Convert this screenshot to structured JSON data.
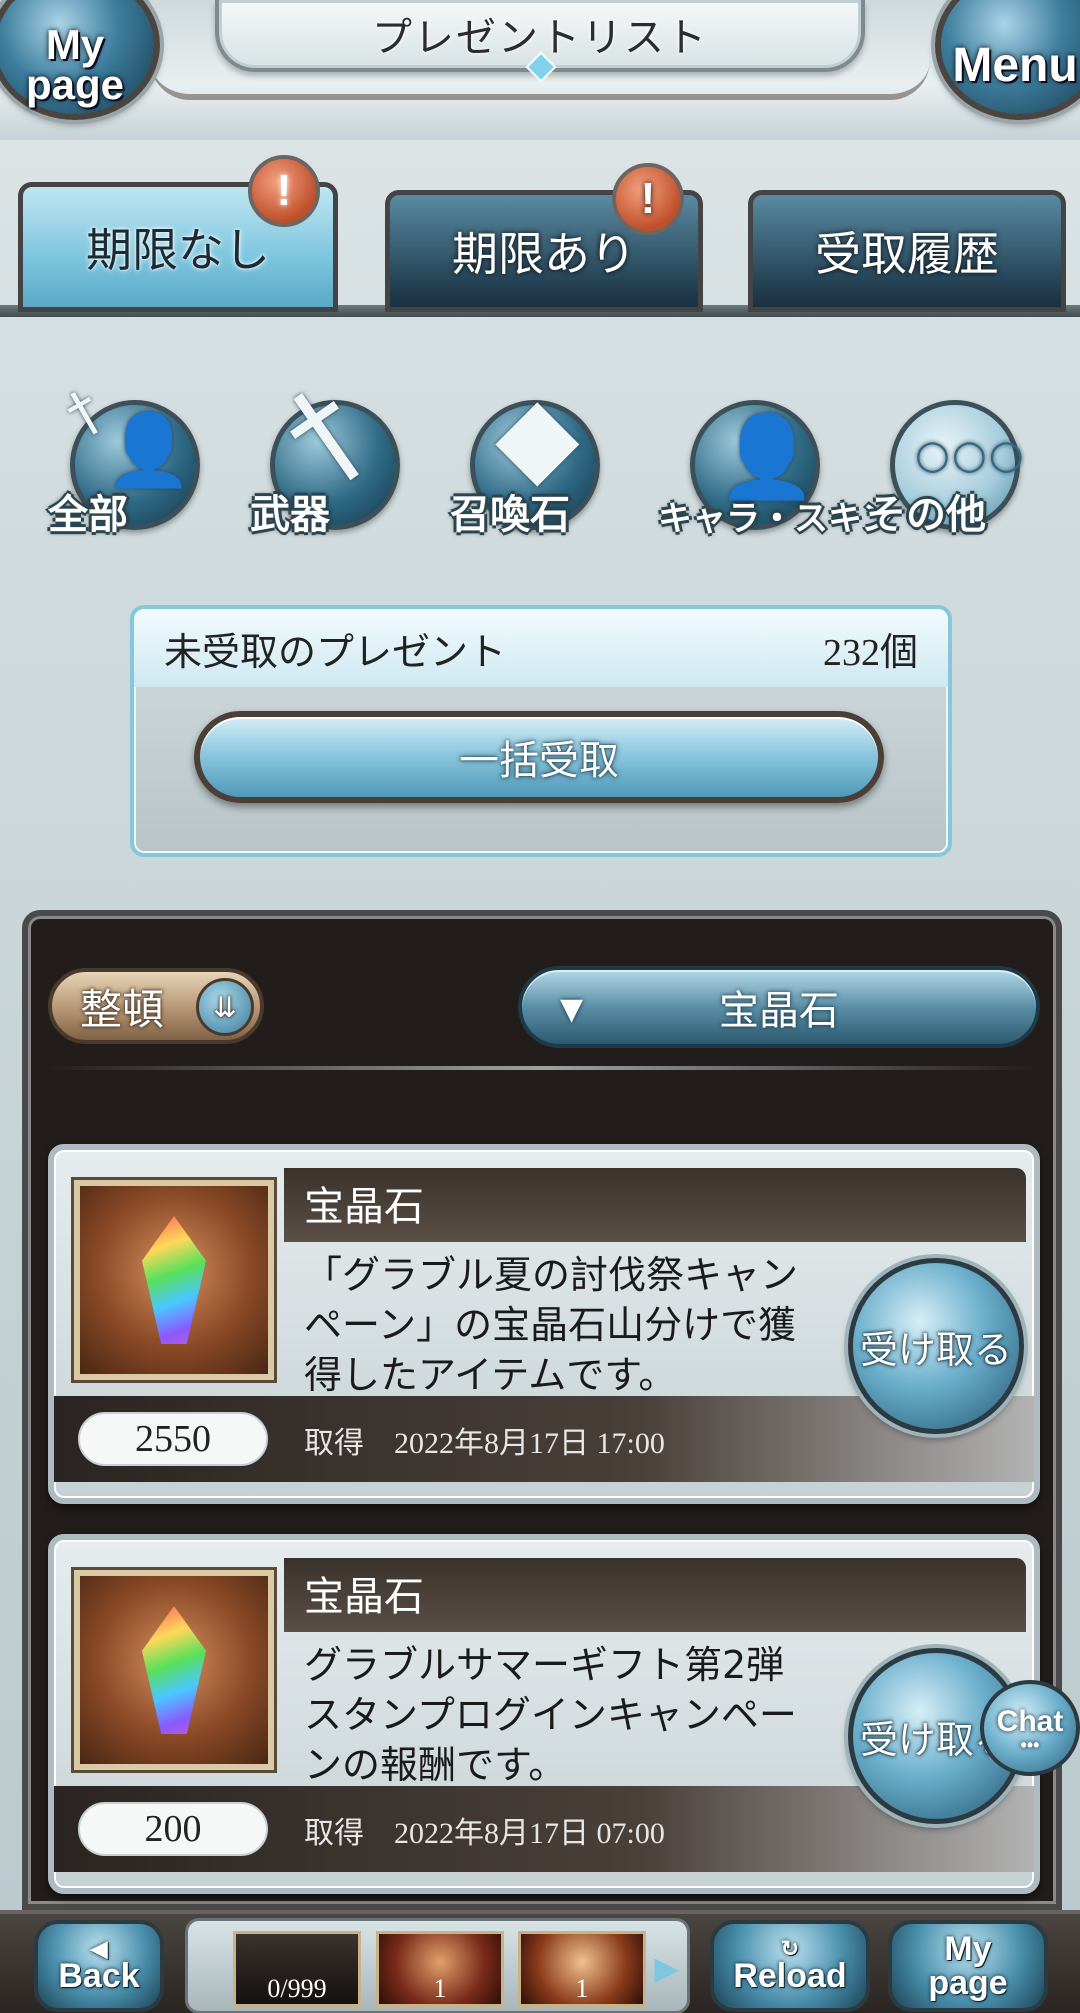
{
  "header": {
    "title": "プレゼントリスト",
    "left_button": "My\npage",
    "right_button": "Menu"
  },
  "tabs": [
    {
      "label": "期限なし",
      "active": true,
      "alert": "!"
    },
    {
      "label": "期限あり",
      "active": false,
      "alert": "!"
    },
    {
      "label": "受取履歴",
      "active": false
    }
  ],
  "categories": [
    {
      "label": "全部",
      "icon": "all-icon"
    },
    {
      "label": "武器",
      "icon": "sword-icon"
    },
    {
      "label": "召喚石",
      "icon": "crystal-icon"
    },
    {
      "label": "キャラ・スキン",
      "icon": "character-icon"
    },
    {
      "label": "その他",
      "icon": "more-icon"
    }
  ],
  "summary": {
    "label": "未受取のプレゼント",
    "count": "232個",
    "bulk_button": "一括受取"
  },
  "list": {
    "sort_label": "整頓",
    "filter_value": "宝晶石"
  },
  "items": [
    {
      "name": "宝晶石",
      "description": "「グラブル夏の討伐祭キャンペーン」の宝晶石山分けで獲得したアイテムです。",
      "quantity": "2550",
      "obtained_label": "取得",
      "obtained_date": "2022年8月17日 17:00",
      "button": "受け取る"
    },
    {
      "name": "宝晶石",
      "description": "グラブルサマーギフト第2弾スタンプログインキャンペーンの報酬です。",
      "quantity": "200",
      "obtained_label": "取得",
      "obtained_date": "2022年8月17日 07:00",
      "button": "受け取る"
    }
  ],
  "chat": {
    "label": "Chat"
  },
  "footer": {
    "back": "Back",
    "reload": "Reload",
    "mypage": "My\npage",
    "slots": [
      "0/999",
      "1",
      "1"
    ]
  }
}
